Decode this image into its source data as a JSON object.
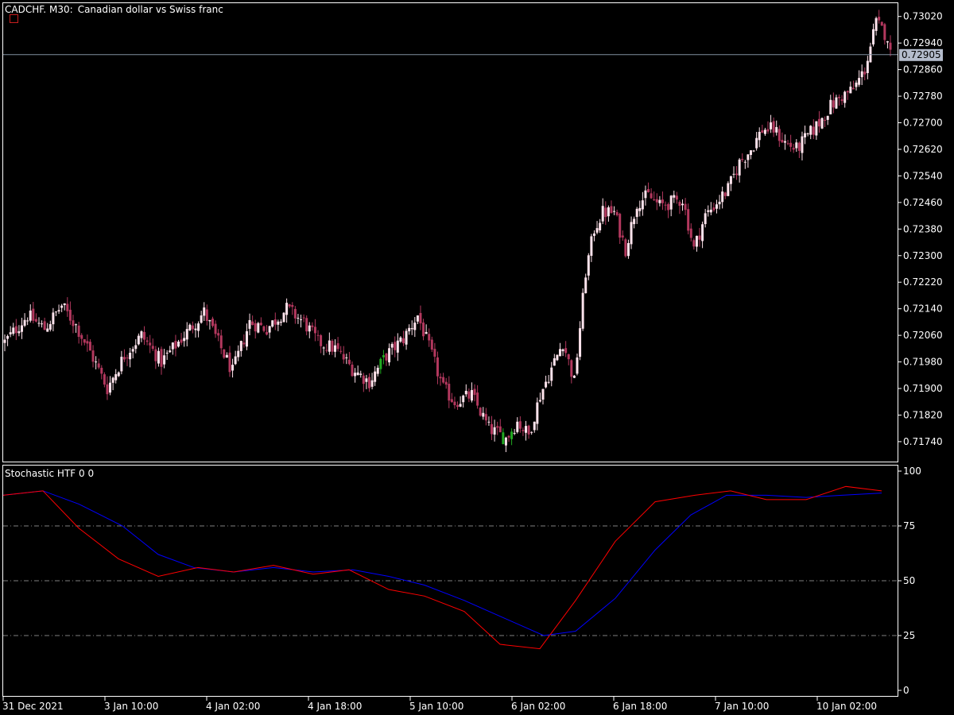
{
  "chart_title": {
    "symbol": "CADCHF.",
    "timeframe": "M30:",
    "description": "Canadian dollar vs Swiss franc"
  },
  "current_price": {
    "label": "0.72905",
    "value": 0.72905
  },
  "indicator": {
    "label": "Stochastic HTF 0 0",
    "levels": [
      25,
      50,
      75
    ],
    "ticks": [
      "100",
      "75",
      "50",
      "25",
      "0"
    ]
  },
  "colors": {
    "background": "#000000",
    "frame": "#ffffff",
    "bull_candle": "#ffe3ec",
    "bear_candle": "#b3385e",
    "green_candle": "#22aa22",
    "main_line": "#0000ff",
    "signal_line": "#ff0000",
    "level_line": "#808080",
    "price_line": "#8090a0",
    "price_tag": "#b4bccc"
  },
  "chart_data": [
    {
      "type": "candlestick",
      "symbol": "CADCHF.",
      "timeframe": "M30",
      "y_ticks": [
        "0.73020",
        "0.72940",
        "0.72860",
        "0.72780",
        "0.72700",
        "0.72620",
        "0.72540",
        "0.72460",
        "0.72380",
        "0.72300",
        "0.72220",
        "0.72140",
        "0.72060",
        "0.71980",
        "0.71900",
        "0.71820",
        "0.71740"
      ],
      "ylim": [
        0.7168,
        0.7306
      ],
      "x_labels": [
        "31 Dec 2021",
        "3 Jan 10:00",
        "4 Jan 02:00",
        "4 Jan 18:00",
        "5 Jan 10:00",
        "6 Jan 02:00",
        "6 Jan 18:00",
        "7 Jan 10:00",
        "10 Jan 02:00"
      ],
      "close_series_anchors": [
        [
          0,
          0.7204
        ],
        [
          8,
          0.7212
        ],
        [
          14,
          0.7208
        ],
        [
          20,
          0.7215
        ],
        [
          25,
          0.7209
        ],
        [
          30,
          0.7201
        ],
        [
          36,
          0.719
        ],
        [
          42,
          0.72
        ],
        [
          48,
          0.7206
        ],
        [
          55,
          0.7198
        ],
        [
          62,
          0.7205
        ],
        [
          70,
          0.7213
        ],
        [
          76,
          0.7202
        ],
        [
          80,
          0.7195
        ],
        [
          86,
          0.721
        ],
        [
          92,
          0.7208
        ],
        [
          99,
          0.7214
        ],
        [
          105,
          0.721
        ],
        [
          110,
          0.7204
        ],
        [
          116,
          0.7202
        ],
        [
          122,
          0.7196
        ],
        [
          128,
          0.7192
        ],
        [
          134,
          0.72
        ],
        [
          140,
          0.7205
        ],
        [
          145,
          0.7212
        ],
        [
          150,
          0.72
        ],
        [
          154,
          0.719
        ],
        [
          158,
          0.7186
        ],
        [
          164,
          0.7188
        ],
        [
          170,
          0.7178
        ],
        [
          176,
          0.7175
        ],
        [
          180,
          0.718
        ],
        [
          184,
          0.7176
        ],
        [
          188,
          0.7188
        ],
        [
          192,
          0.7196
        ],
        [
          196,
          0.7204
        ],
        [
          200,
          0.7192
        ],
        [
          204,
          0.7225
        ],
        [
          207,
          0.7238
        ],
        [
          210,
          0.7243
        ],
        [
          214,
          0.7243
        ],
        [
          218,
          0.7232
        ],
        [
          222,
          0.7246
        ],
        [
          226,
          0.7248
        ],
        [
          230,
          0.7245
        ],
        [
          234,
          0.7246
        ],
        [
          238,
          0.7247
        ],
        [
          242,
          0.7232
        ],
        [
          246,
          0.7242
        ],
        [
          250,
          0.7246
        ],
        [
          254,
          0.725
        ],
        [
          258,
          0.7258
        ],
        [
          262,
          0.7262
        ],
        [
          266,
          0.7268
        ],
        [
          270,
          0.7268
        ],
        [
          274,
          0.7264
        ],
        [
          278,
          0.7262
        ],
        [
          282,
          0.7266
        ],
        [
          286,
          0.727
        ],
        [
          290,
          0.7275
        ],
        [
          294,
          0.7278
        ],
        [
          298,
          0.728
        ],
        [
          302,
          0.7286
        ],
        [
          306,
          0.73
        ],
        [
          310,
          0.7296
        ],
        [
          311,
          0.72905
        ]
      ],
      "close_series_total_bars": 312
    },
    {
      "type": "line",
      "title": "Stochastic HTF 0 0",
      "ylim": [
        0,
        100
      ],
      "levels": [
        25,
        50,
        75
      ],
      "series": [
        {
          "color": "#0000ff",
          "points": [
            [
              0,
              89
            ],
            [
              50,
              91
            ],
            [
              95,
              85
            ],
            [
              150,
              75
            ],
            [
              195,
              62
            ],
            [
              240,
              56
            ],
            [
              290,
              54
            ],
            [
              340,
              56
            ],
            [
              390,
              54
            ],
            [
              440,
              55
            ],
            [
              485,
              52
            ],
            [
              530,
              48
            ],
            [
              580,
              41
            ],
            [
              630,
              33
            ],
            [
              680,
              25
            ],
            [
              720,
              27
            ],
            [
              770,
              42
            ],
            [
              820,
              64
            ],
            [
              865,
              80
            ],
            [
              910,
              89
            ],
            [
              960,
              89
            ],
            [
              1010,
              88
            ],
            [
              1055,
              89
            ],
            [
              1105,
              90
            ]
          ]
        },
        {
          "color": "#ff0000",
          "points": [
            [
              0,
              89
            ],
            [
              50,
              91
            ],
            [
              95,
              74
            ],
            [
              145,
              60
            ],
            [
              195,
              52
            ],
            [
              245,
              56
            ],
            [
              290,
              54
            ],
            [
              340,
              57
            ],
            [
              390,
              53
            ],
            [
              435,
              55
            ],
            [
              485,
              46
            ],
            [
              530,
              43
            ],
            [
              580,
              36
            ],
            [
              625,
              21
            ],
            [
              675,
              19
            ],
            [
              720,
              41
            ],
            [
              770,
              68
            ],
            [
              820,
              86
            ],
            [
              870,
              89
            ],
            [
              915,
              91
            ],
            [
              960,
              87
            ],
            [
              1010,
              87
            ],
            [
              1060,
              93
            ],
            [
              1105,
              91
            ]
          ]
        }
      ]
    }
  ]
}
